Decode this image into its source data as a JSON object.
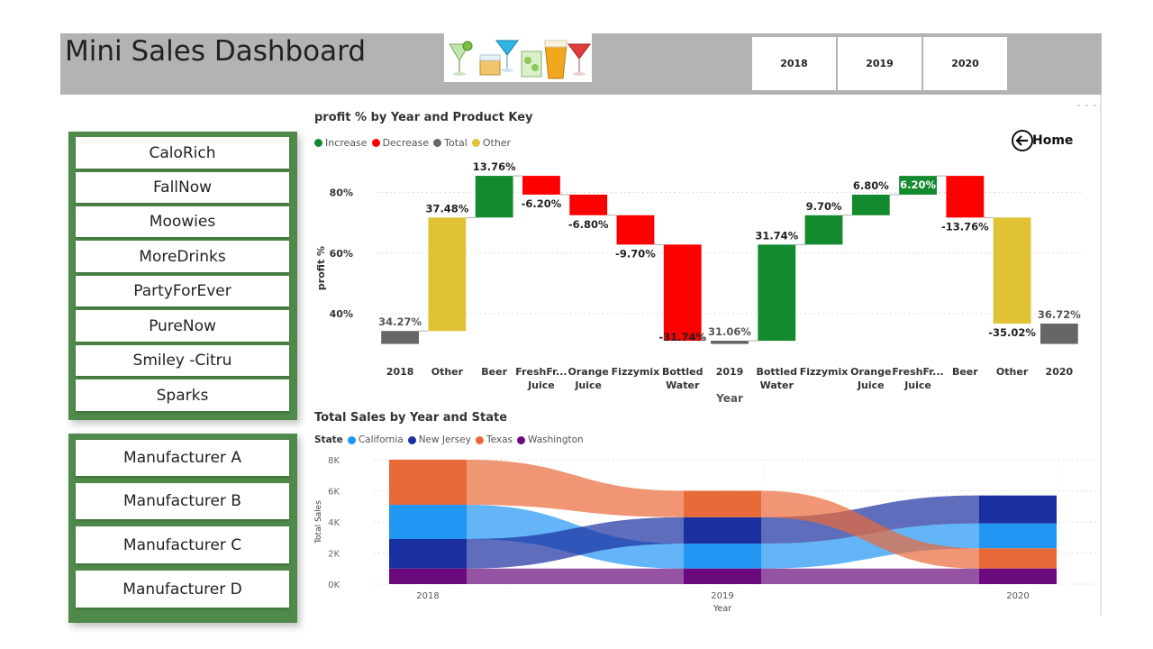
{
  "header": {
    "title": "Mini Sales Dashboard",
    "logo_icon": "drinks-glasses-icon",
    "year_buttons": [
      "2018",
      "2019",
      "2020"
    ]
  },
  "products": [
    "CaloRich",
    "FallNow",
    "Moowies",
    "MoreDrinks",
    "PartyForEver",
    "PureNow",
    "Smiley -Citru",
    "Sparks"
  ],
  "manufacturers": [
    "Manufacturer A",
    "Manufacturer B",
    "Manufacturer C",
    "Manufacturer D"
  ],
  "home_button": {
    "label": "Home",
    "icon": "back-arrow-circle-icon"
  },
  "more_options": "- - -",
  "colors": {
    "increase": "#138a2d",
    "decrease": "#fd0000",
    "total": "#666666",
    "other": "#e0c234",
    "california": "#2196f3",
    "new_jersey": "#1a2fa0",
    "texas": "#e96a39",
    "washington": "#6a0a7d",
    "panel_green": "#4f8a4a"
  },
  "chart_data": [
    {
      "type": "waterfall",
      "title": "profit % by Year and Product Key",
      "xlabel": "Year",
      "ylabel": "profit %",
      "legend": [
        "Increase",
        "Decrease",
        "Total",
        "Other"
      ],
      "legend_placement": "top-left",
      "yticks": [
        "40%",
        "60%",
        "80%"
      ],
      "ylim": [
        26,
        90
      ],
      "bars": [
        {
          "label": "2018",
          "kind": "total",
          "low": 30,
          "high": 34.27,
          "value_label": "34.27%"
        },
        {
          "label": "Other",
          "kind": "other",
          "low": 34.27,
          "high": 71.75,
          "value_label": "37.48%"
        },
        {
          "label": "Beer",
          "kind": "increase",
          "low": 71.75,
          "high": 85.51,
          "value_label": "13.76%"
        },
        {
          "label": "FreshFr... Juice",
          "kind": "decrease",
          "low": 79.31,
          "high": 85.51,
          "value_label": "-6.20%"
        },
        {
          "label": "Orange Juice",
          "kind": "decrease",
          "low": 72.51,
          "high": 79.31,
          "value_label": "-6.80%"
        },
        {
          "label": "Fizzymix",
          "kind": "decrease",
          "low": 62.81,
          "high": 72.51,
          "value_label": "-9.70%"
        },
        {
          "label": "Bottled Water",
          "kind": "decrease",
          "low": 31.06,
          "high": 62.81,
          "value_label": "-31.74%"
        },
        {
          "label": "2019",
          "kind": "total",
          "low": 30,
          "high": 31.06,
          "value_label": "31.06%"
        },
        {
          "label": "Bottled Water",
          "kind": "increase",
          "low": 31.06,
          "high": 62.8,
          "value_label": "31.74%"
        },
        {
          "label": "Fizzymix",
          "kind": "increase",
          "low": 62.8,
          "high": 72.5,
          "value_label": "9.70%"
        },
        {
          "label": "Orange Juice",
          "kind": "increase",
          "low": 72.5,
          "high": 79.3,
          "value_label": "6.80%"
        },
        {
          "label": "FreshFr... Juice",
          "kind": "increase",
          "low": 79.3,
          "high": 85.5,
          "value_label": "6.20%"
        },
        {
          "label": "Beer",
          "kind": "decrease",
          "low": 71.74,
          "high": 85.5,
          "value_label": "-13.76%"
        },
        {
          "label": "Other",
          "kind": "other",
          "low": 36.72,
          "high": 71.74,
          "value_label": "-35.02%"
        },
        {
          "label": "2020",
          "kind": "total",
          "low": 30,
          "high": 36.72,
          "value_label": "36.72%"
        }
      ]
    },
    {
      "type": "ribbon",
      "title": "Total Sales by Year and State",
      "xlabel": "Year",
      "ylabel": "Total Sales",
      "legend_title": "State",
      "legend_placement": "top-left",
      "categories": [
        "2018",
        "2019",
        "2020"
      ],
      "yticks": [
        "0K",
        "2K",
        "4K",
        "6K",
        "8K"
      ],
      "ylim": [
        0,
        8000
      ],
      "series": [
        {
          "name": "California",
          "values": [
            2200,
            1600,
            1600
          ]
        },
        {
          "name": "New Jersey",
          "values": [
            1900,
            1700,
            1800
          ]
        },
        {
          "name": "Texas",
          "values": [
            2900,
            1700,
            1300
          ]
        },
        {
          "name": "Washington",
          "values": [
            1000,
            1000,
            1000
          ]
        }
      ]
    }
  ]
}
